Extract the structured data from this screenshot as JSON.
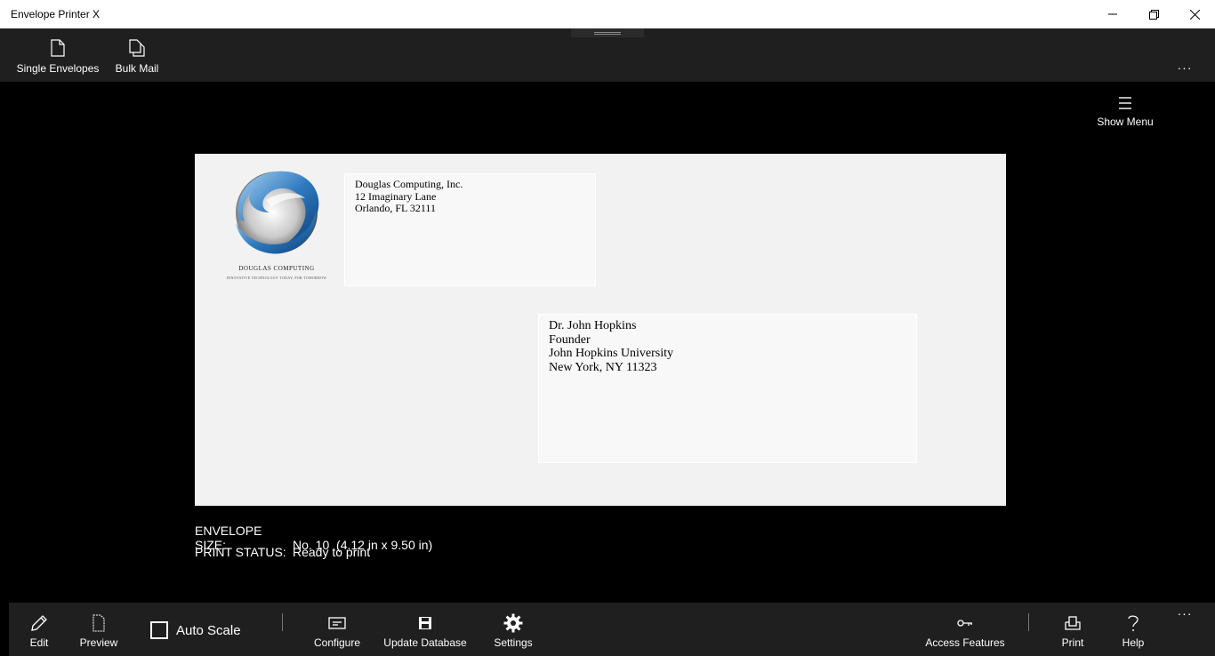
{
  "window": {
    "title": "Envelope Printer X"
  },
  "topbar": {
    "single_envelopes": "Single Envelopes",
    "bulk_mail": "Bulk Mail",
    "more": "···"
  },
  "show_menu": {
    "label": "Show Menu"
  },
  "envelope": {
    "logo": {
      "company": "DOUGLAS COMPUTING",
      "tagline": "INNOVATIVE TECHNOLOGY TODAY, FOR TOMORROW"
    },
    "return_address": [
      "Douglas Computing, Inc.",
      "12 Imaginary Lane",
      "Orlando, FL 32111"
    ],
    "recipient_address": [
      "Dr. John Hopkins",
      "Founder",
      "John Hopkins University",
      "New York, NY 11323"
    ]
  },
  "status": {
    "size_label": "ENVELOPE SIZE:",
    "size_value": "No. 10  (4.12 in x 9.50 in)",
    "print_label": "PRINT STATUS:",
    "print_value": "Ready to print"
  },
  "bottombar": {
    "edit": "Edit",
    "preview": "Preview",
    "auto_scale": "Auto Scale",
    "auto_scale_checked": false,
    "configure": "Configure",
    "update_database": "Update Database",
    "settings": "Settings",
    "access_features": "Access Features",
    "print": "Print",
    "help": "Help",
    "more": "···"
  }
}
